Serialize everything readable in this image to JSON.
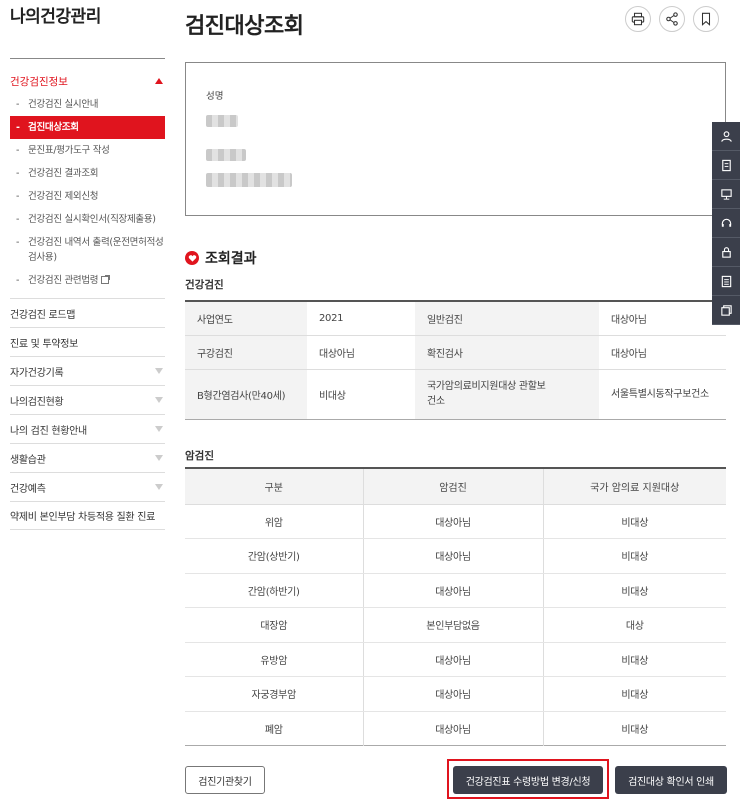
{
  "sidebar": {
    "title": "나의건강관리",
    "section": "건강검진정보",
    "sub_items": [
      {
        "label": "건강검진 실시안내"
      },
      {
        "label": "검진대상조회"
      },
      {
        "label": "문진표/평가도구 작성"
      },
      {
        "label": "건강검진 결과조회"
      },
      {
        "label": "건강검진 제외신청"
      },
      {
        "label": "건강검진 실시확인서(직장제출용)"
      },
      {
        "label": "건강검진 내역서 출력(운전면허적성검사용)"
      },
      {
        "label": "건강검진 관련법령"
      }
    ],
    "menu": [
      {
        "label": "건강검진 로드맵"
      },
      {
        "label": "진료 및 투약정보"
      },
      {
        "label": "자가건강기록"
      },
      {
        "label": "나의검진현황"
      },
      {
        "label": "나의 검진 현황안내"
      },
      {
        "label": "생활습관"
      },
      {
        "label": "건강예측"
      },
      {
        "label": "약제비 본인부담 차등적용 질환 진료"
      }
    ]
  },
  "main": {
    "title": "검진대상조회",
    "user_label": "성명",
    "result_title": "조회결과",
    "general": {
      "title": "건강검진",
      "rows": [
        [
          "사업연도",
          "2021",
          "일반검진",
          "대상아님"
        ],
        [
          "구강검진",
          "대상아님",
          "확진검사",
          "대상아님"
        ],
        [
          "B형간염검사(만40세)",
          "비대상",
          "국가암의료비지원대상 관할보건소",
          "서울특별시동작구보건소"
        ]
      ]
    },
    "cancer": {
      "title": "암검진",
      "headers": [
        "구분",
        "암검진",
        "국가 암의료 지원대상"
      ],
      "rows": [
        [
          "위암",
          "대상아님",
          "비대상"
        ],
        [
          "간암(상반기)",
          "대상아님",
          "비대상"
        ],
        [
          "간암(하반기)",
          "대상아님",
          "비대상"
        ],
        [
          "대장암",
          "본인부담없음",
          "대상"
        ],
        [
          "유방암",
          "대상아님",
          "비대상"
        ],
        [
          "자궁경부암",
          "대상아님",
          "비대상"
        ],
        [
          "폐암",
          "대상아님",
          "비대상"
        ]
      ]
    },
    "buttons": {
      "find_org": "검진기관찾기",
      "change_method": "건강검진표 수령방법 변경/신청",
      "print_confirm": "검진대상 확인서 인쇄"
    }
  },
  "colors": {
    "accent": "#e0141e",
    "dark": "#3b3f4b"
  }
}
